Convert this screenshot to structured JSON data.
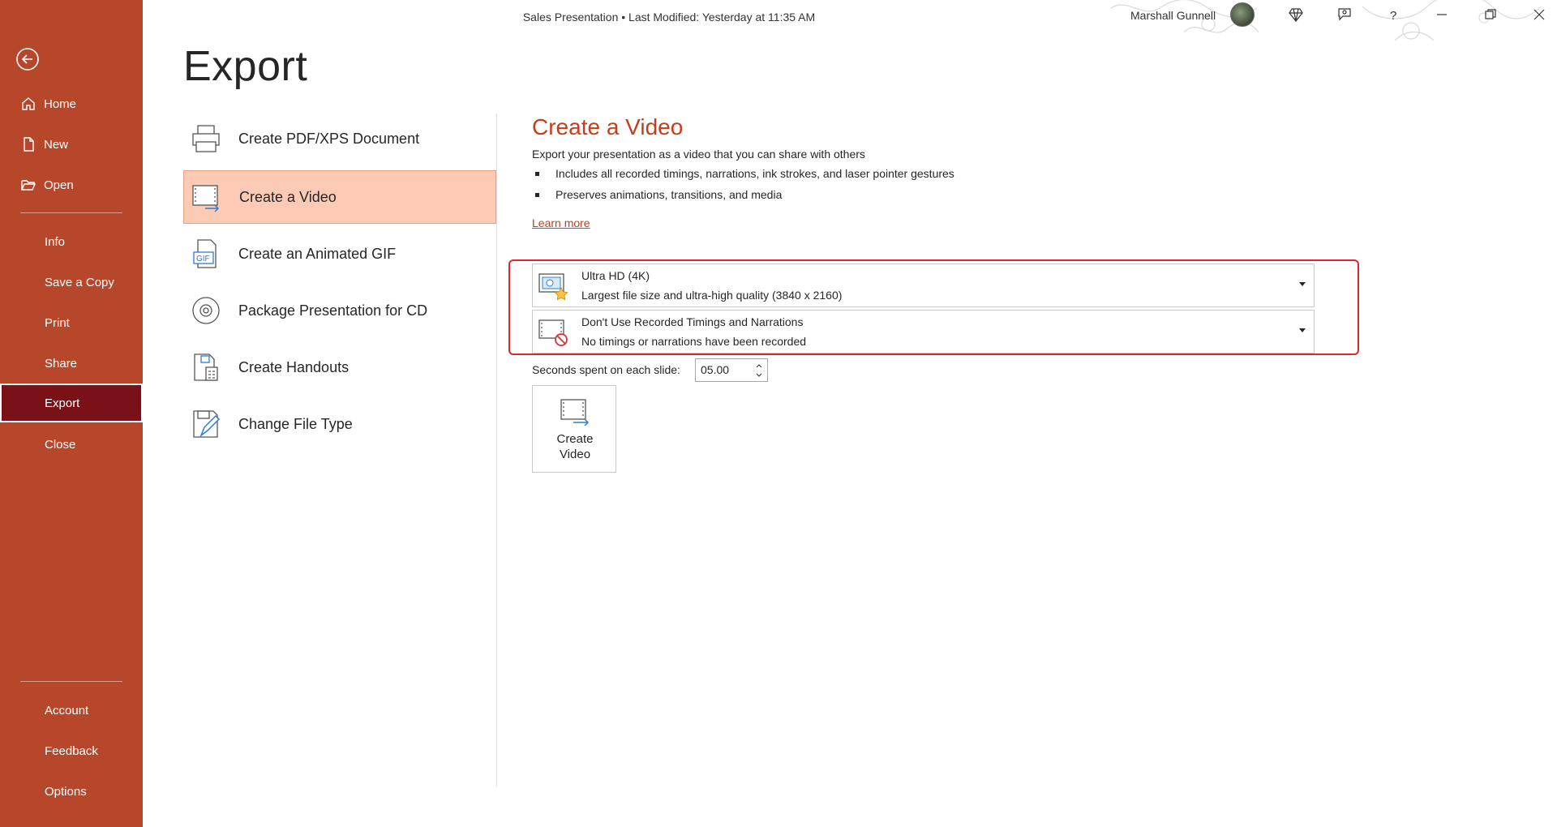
{
  "titlebar": {
    "document_title": "Sales Presentation • Last Modified: Yesterday at 11:35 AM",
    "user_name": "Marshall Gunnell"
  },
  "nav": {
    "items": [
      {
        "label": "Home"
      },
      {
        "label": "New"
      },
      {
        "label": "Open"
      },
      {
        "label": "Info"
      },
      {
        "label": "Save a Copy"
      },
      {
        "label": "Print"
      },
      {
        "label": "Share"
      },
      {
        "label": "Export"
      },
      {
        "label": "Close"
      },
      {
        "label": "Account"
      },
      {
        "label": "Feedback"
      },
      {
        "label": "Options"
      }
    ],
    "active": "Export"
  },
  "page": {
    "title": "Export"
  },
  "export_options": [
    {
      "label": "Create PDF/XPS Document",
      "icon": "pdf-document-icon"
    },
    {
      "label": "Create a Video",
      "icon": "video-icon"
    },
    {
      "label": "Create an Animated GIF",
      "icon": "gif-icon"
    },
    {
      "label": "Package Presentation for CD",
      "icon": "cd-icon"
    },
    {
      "label": "Create Handouts",
      "icon": "handouts-icon"
    },
    {
      "label": "Change File Type",
      "icon": "change-file-type-icon"
    }
  ],
  "video_pane": {
    "title": "Create a Video",
    "description": "Export your presentation as a video that you can share with others",
    "bullets": [
      "Includes all recorded timings, narrations, ink strokes, and laser pointer gestures",
      "Preserves animations, transitions, and media"
    ],
    "learn_more": "Learn more",
    "quality_dropdown": {
      "title": "Ultra HD (4K)",
      "subtitle": "Largest file size and ultra-high quality (3840 x 2160)"
    },
    "timings_dropdown": {
      "title": "Don't Use Recorded Timings and Narrations",
      "subtitle": "No timings or narrations have been recorded"
    },
    "seconds_label": "Seconds spent on each slide:",
    "seconds_value": "05.00",
    "create_button": {
      "line1": "Create",
      "line2": "Video"
    }
  },
  "colors": {
    "nav_background": "#b7472a",
    "nav_active": "#7a1018",
    "accent": "#c43e1c",
    "selected_option": "#fccab5",
    "highlight_box": "#e0252b"
  }
}
